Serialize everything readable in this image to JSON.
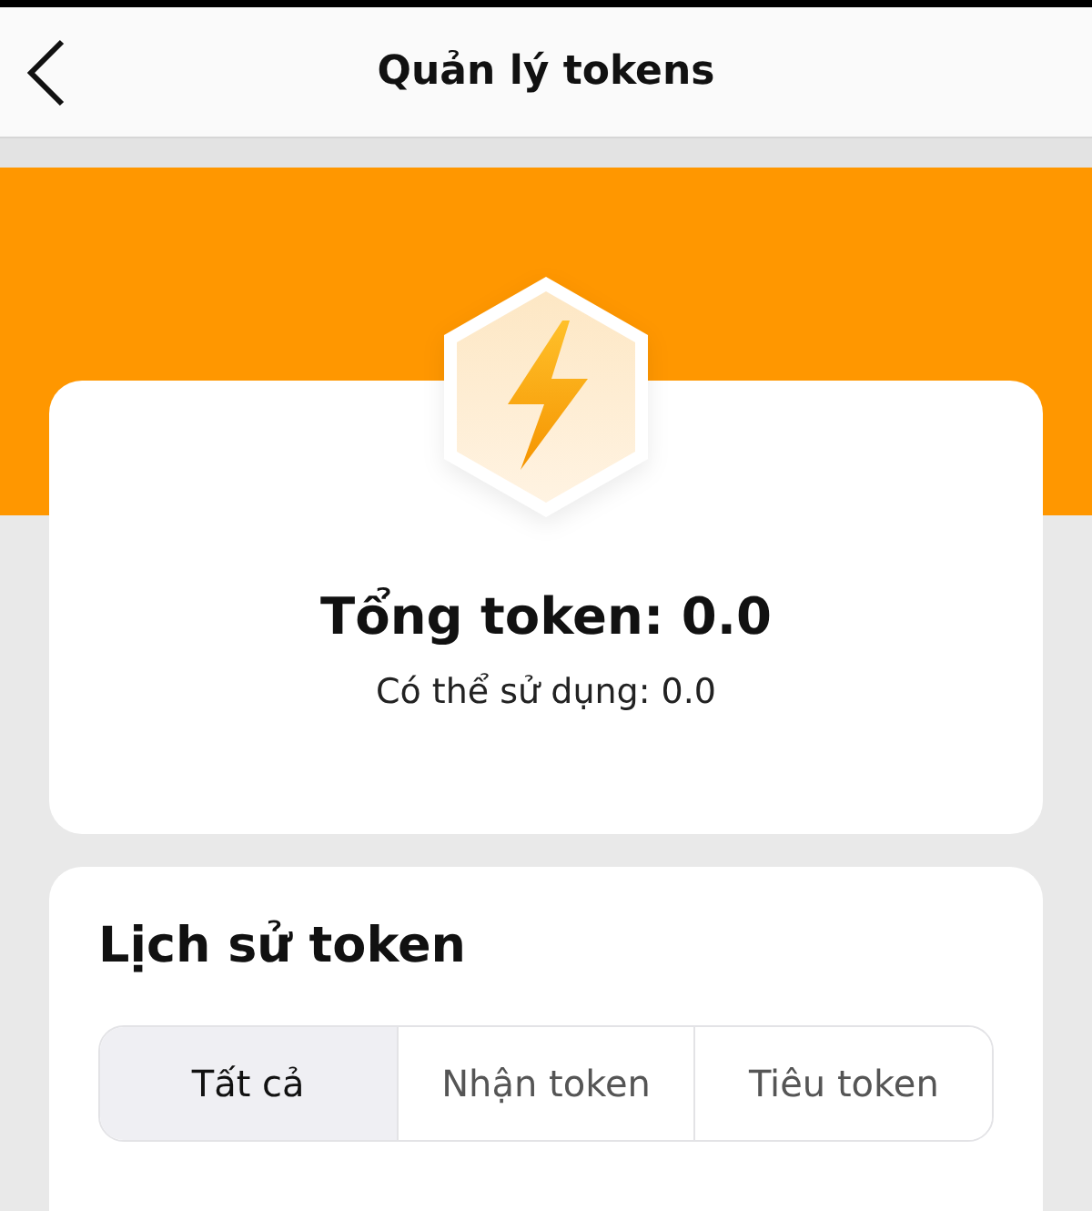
{
  "header": {
    "title": "Quản lý tokens"
  },
  "summary": {
    "total": "Tổng token: 0.0",
    "available": "Có thể sử dụng: 0.0"
  },
  "history": {
    "title": "Lịch sử token",
    "tabs": [
      {
        "label": "Tất cả",
        "selected": true
      },
      {
        "label": "Nhận token",
        "selected": false
      },
      {
        "label": "Tiêu token",
        "selected": false
      }
    ]
  }
}
